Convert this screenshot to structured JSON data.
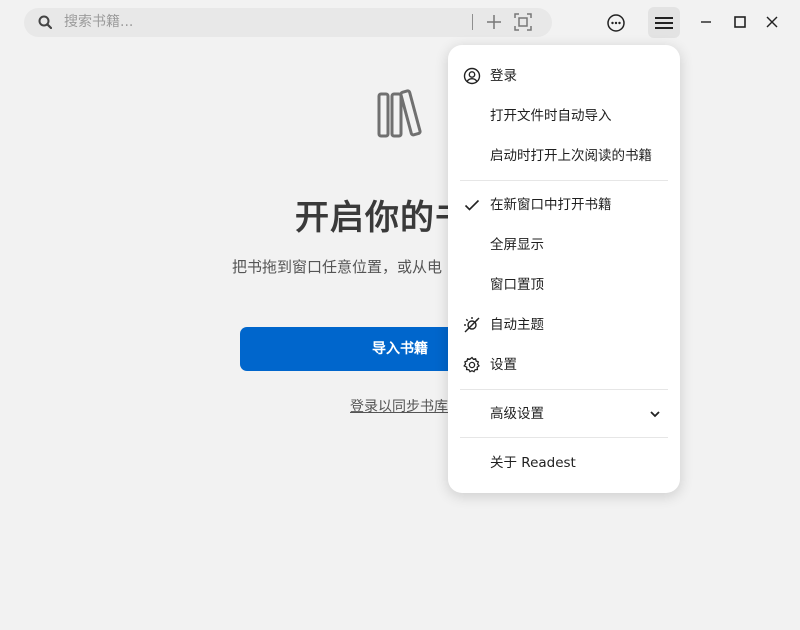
{
  "search": {
    "placeholder": "搜索书籍..."
  },
  "empty_state": {
    "title": "开启你的书",
    "subtitle": "把书拖到窗口任意位置，或从电",
    "import_button": "导入书籍",
    "login_link": "登录以同步书库"
  },
  "menu": {
    "items": [
      {
        "label": "登录",
        "icon": "user-circle-icon"
      },
      {
        "label": "打开文件时自动导入"
      },
      {
        "label": "启动时打开上次阅读的书籍"
      },
      {
        "label": "在新窗口中打开书籍",
        "icon": "check-icon"
      },
      {
        "label": "全屏显示"
      },
      {
        "label": "窗口置顶"
      },
      {
        "label": "自动主题",
        "icon": "theme-auto-icon"
      },
      {
        "label": "设置",
        "icon": "gear-icon"
      },
      {
        "label": "高级设置",
        "icon": "chevron-down-icon"
      },
      {
        "label": "关于 Readest"
      }
    ]
  },
  "colors": {
    "accent": "#0066cc",
    "background": "#f2f2f2",
    "menu_bg": "#ffffff"
  }
}
